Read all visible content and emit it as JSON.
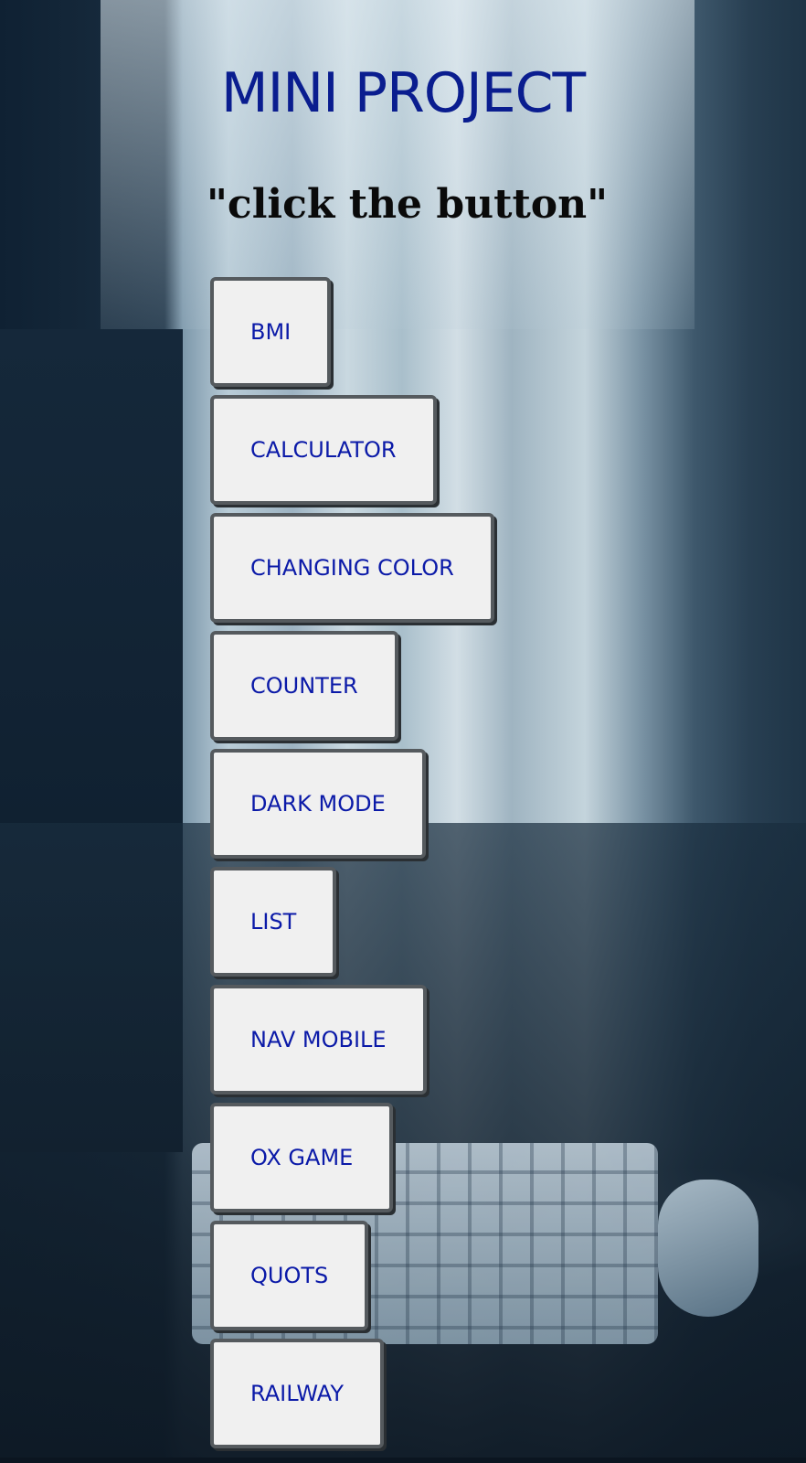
{
  "header": {
    "title": "MINI PROJECT",
    "subtitle": "\"click the button\""
  },
  "buttons": [
    {
      "label": "BMI"
    },
    {
      "label": "CALCULATOR"
    },
    {
      "label": "CHANGING COLOR"
    },
    {
      "label": "COUNTER"
    },
    {
      "label": "DARK MODE"
    },
    {
      "label": "LIST"
    },
    {
      "label": "NAV MOBILE"
    },
    {
      "label": "OX GAME"
    },
    {
      "label": "QUOTS"
    },
    {
      "label": "RAILWAY"
    }
  ],
  "colors": {
    "title": "#0a1d8f",
    "button_text": "#0b1aa8",
    "button_bg": "#f0f0f0",
    "button_border": "#555a5e"
  }
}
